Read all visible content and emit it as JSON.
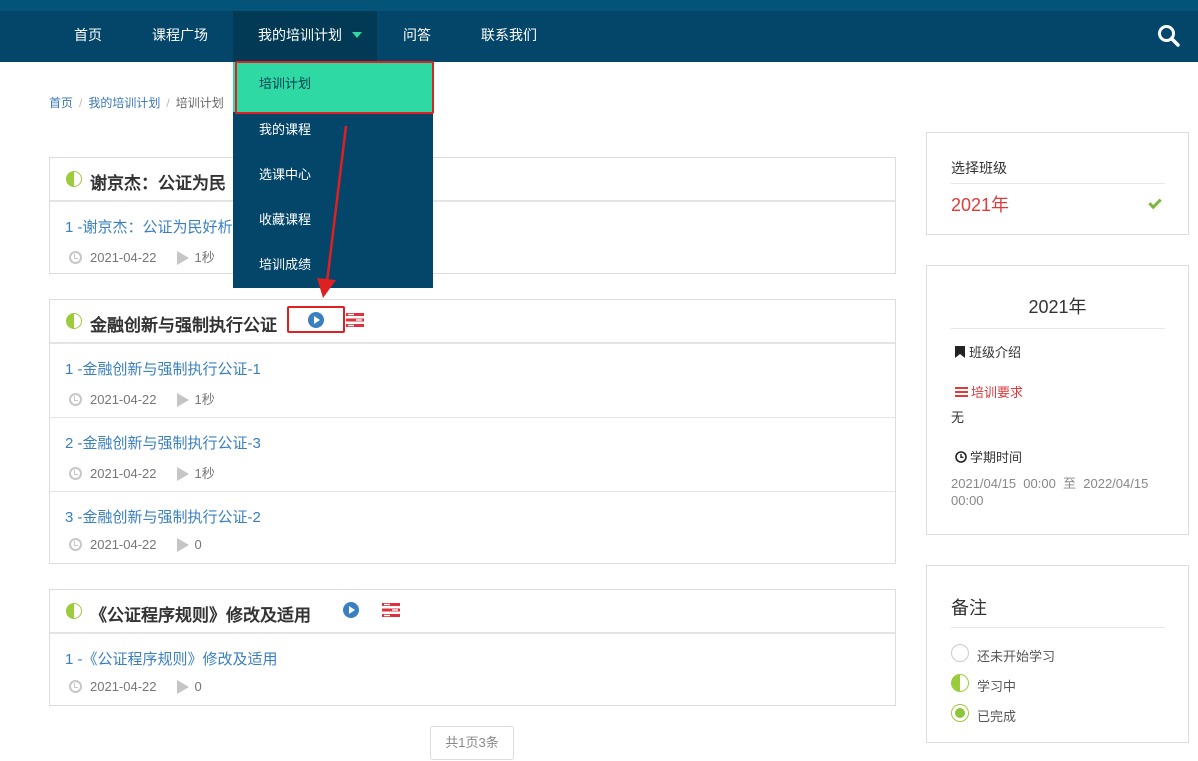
{
  "nav": {
    "items": [
      "首页",
      "课程广场",
      "我的培训计划",
      "问答",
      "联系我们"
    ],
    "dropdown": [
      "培训计划",
      "我的课程",
      "选课中心",
      "收藏课程",
      "培训成绩"
    ]
  },
  "breadcrumb": [
    "首页",
    "我的培训计划",
    "培训计划"
  ],
  "courses": [
    {
      "title": "谢京杰：公证为民",
      "rows": [
        {
          "title": "1 -谢京杰：公证为民好析",
          "date": "2021-04-22",
          "duration": "1秒"
        }
      ]
    },
    {
      "title": "金融创新与强制执行公证",
      "rows": [
        {
          "title": "1 -金融创新与强制执行公证-1",
          "date": "2021-04-22",
          "duration": "1秒"
        },
        {
          "title": "2 -金融创新与强制执行公证-3",
          "date": "2021-04-22",
          "duration": "1秒"
        },
        {
          "title": "3 -金融创新与强制执行公证-2",
          "date": "2021-04-22",
          "duration": "0"
        }
      ]
    },
    {
      "title": "《公证程序规则》修改及适用",
      "rows": [
        {
          "title": "1 -《公证程序规则》修改及适用",
          "date": "2021-04-22",
          "duration": "0"
        }
      ]
    }
  ],
  "pager": "共1页3条",
  "class_select": {
    "label": "选择班级",
    "value": "2021年"
  },
  "class_info": {
    "title": "2021年",
    "intro_label": "班级介绍",
    "req_label": "培训要求",
    "req_value": "无",
    "term_label": "学期时间",
    "term_line1": "2021/04/15  00:00  至  2022/04/15",
    "term_line2": "00:00"
  },
  "notes": {
    "title": "备注",
    "items": [
      "还未开始学习",
      "学习中",
      "已完成"
    ]
  },
  "colors": {
    "nav_bg": "#03466a",
    "accent_green": "#2fd9a4",
    "link_blue": "#3a80c1",
    "alert_red": "#e02020"
  }
}
